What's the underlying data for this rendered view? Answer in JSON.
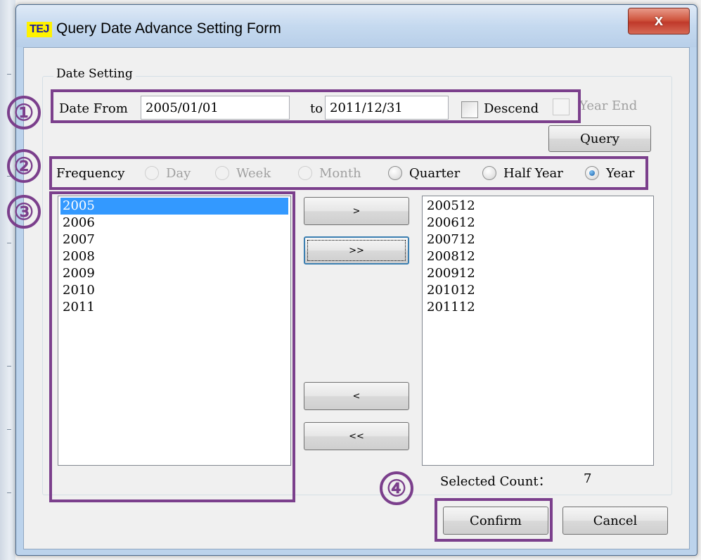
{
  "window": {
    "app_logo": "TEJ",
    "title": "Query Date Advance Setting Form",
    "close_label": "x"
  },
  "date_setting": {
    "group_title": "Date Setting",
    "date_from_label": "Date From",
    "date_from_value": "2005/01/01",
    "to_label": "to",
    "date_to_value": "2011/12/31",
    "descend_label": "Descend",
    "descend_checked": false,
    "year_end_label": "Year End",
    "year_end_enabled": false,
    "query_button": "Query"
  },
  "frequency": {
    "label": "Frequency",
    "options": [
      {
        "label": "Day",
        "enabled": false,
        "checked": false
      },
      {
        "label": "Week",
        "enabled": false,
        "checked": false
      },
      {
        "label": "Month",
        "enabled": false,
        "checked": false
      },
      {
        "label": "Quarter",
        "enabled": true,
        "checked": false
      },
      {
        "label": "Half Year",
        "enabled": true,
        "checked": false
      },
      {
        "label": "Year",
        "enabled": true,
        "checked": true
      }
    ]
  },
  "available_list": {
    "items": [
      "2005",
      "2006",
      "2007",
      "2008",
      "2009",
      "2010",
      "2011"
    ],
    "selected_index": 0
  },
  "transfer_buttons": {
    "add_one": ">",
    "add_all": ">>",
    "remove_one": "<",
    "remove_all": "<<"
  },
  "selected_list": {
    "items": [
      "200512",
      "200612",
      "200712",
      "200812",
      "200912",
      "201012",
      "201112"
    ]
  },
  "selected_count": {
    "label": "Selected Count：",
    "value": "7"
  },
  "actions": {
    "confirm": "Confirm",
    "cancel": "Cancel"
  },
  "annotations": [
    "①",
    "②",
    "③",
    "④"
  ],
  "colors": {
    "annotation": "#7b3f8c",
    "selection": "#3399ff",
    "close_button": "#c0392b",
    "logo_background": "#fff200"
  }
}
